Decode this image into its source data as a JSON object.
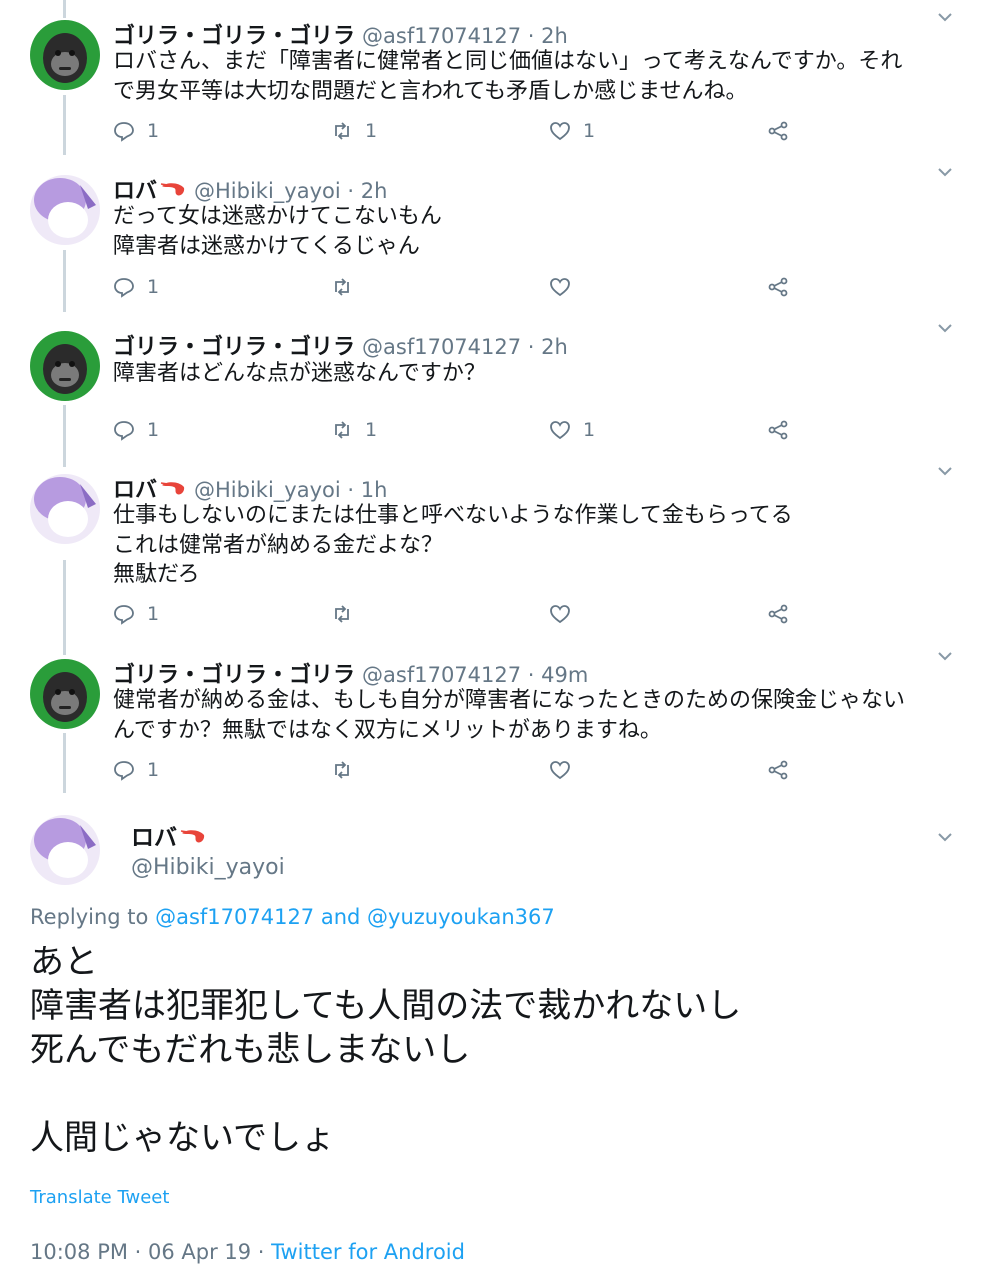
{
  "tweets": [
    {
      "name": "ゴリラ・ゴリラ・ゴリラ",
      "handle_time": "@asf17074127 · 2h",
      "lines": [
        "ロバさん、まだ「障害者に健常者と同じ価値はない」って考えなんですか。それ",
        "で男女平等は大切な問題だと言われても矛盾しか感じませんね。"
      ],
      "replies": "1",
      "retweets": "1",
      "likes": "1"
    },
    {
      "name": "ロバ",
      "handle_time": "@Hibiki_yayoi · 2h",
      "lines": [
        "だって女は迷惑かけてこないもん",
        "障害者は迷惑かけてくるじゃん"
      ],
      "replies": "1",
      "retweets": "",
      "likes": ""
    },
    {
      "name": "ゴリラ・ゴリラ・ゴリラ",
      "handle_time": "@asf17074127 · 2h",
      "lines": [
        "障害者はどんな点が迷惑なんですか？"
      ],
      "replies": "1",
      "retweets": "1",
      "likes": "1"
    },
    {
      "name": "ロバ",
      "handle_time": "@Hibiki_yayoi · 1h",
      "lines": [
        "仕事もしないのにまたは仕事と呼べないような作業して金もらってる",
        "これは健常者が納める金だよな？",
        "無駄だろ"
      ],
      "replies": "1",
      "retweets": "",
      "likes": ""
    },
    {
      "name": "ゴリラ・ゴリラ・ゴリラ",
      "handle_time": "@asf17074127 · 49m",
      "lines": [
        "健常者が納める金は、もしも自分が障害者になったときのための保険金じゃない",
        "んですか？無駄ではなく双方にメリットがありますね。"
      ],
      "replies": "1",
      "retweets": "",
      "likes": ""
    }
  ],
  "main": {
    "name": "ロバ",
    "handle": "@Hibiki_yayoi",
    "replying_prefix": "Replying to ",
    "replying_to_1": "@asf17074127",
    "replying_and": " and ",
    "replying_to_2": "@yuzuyoukan367",
    "lines": [
      "あと",
      "障害者は犯罪犯しても人間の法で裁かれないし",
      "死んでもだれも悲しまないし",
      "",
      "人間じゃないでしょ"
    ],
    "translate": "Translate Tweet",
    "timestamp": "10:08 PM · 06 Apr 19 · ",
    "client": "Twitter for Android"
  },
  "icons": {
    "reply": "reply-icon",
    "retweet": "retweet-icon",
    "like": "heart-icon",
    "share": "share-icon",
    "more": "chevron-down-icon",
    "emoji": "shrimp-emoji"
  },
  "colors": {
    "link": "#1da1f2",
    "muted": "#657786",
    "thread_line": "#ccd6dd",
    "gorilla_avatar_bg": "#2a9d3a"
  }
}
